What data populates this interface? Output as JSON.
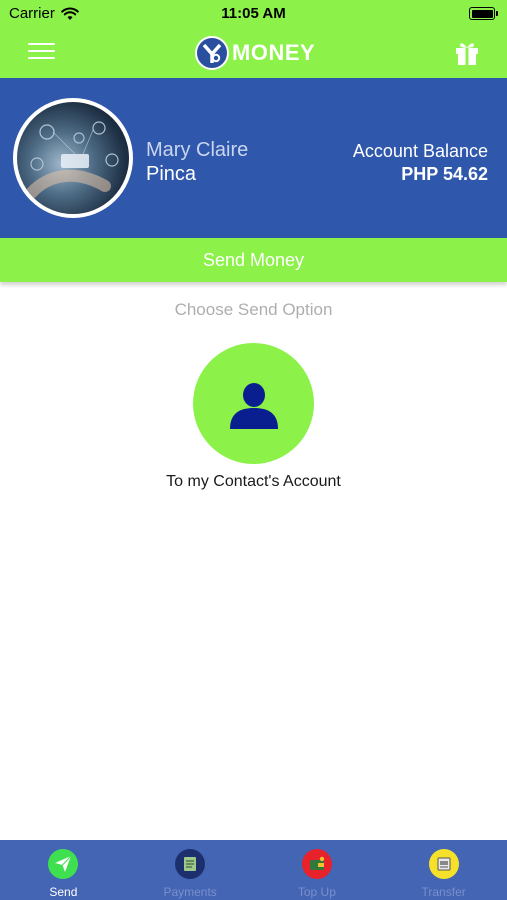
{
  "status": {
    "carrier": "Carrier",
    "time": "11:05 AM"
  },
  "header": {
    "logo_text": "MONEY"
  },
  "profile": {
    "first_name": "Mary Claire",
    "last_name": "Pinca",
    "balance_label": "Account Balance",
    "balance_value": "PHP 54.62"
  },
  "send_bar": {
    "label": "Send Money"
  },
  "main": {
    "choose_text": "Choose Send Option",
    "option_label": "To my Contact's Account"
  },
  "tabs": [
    {
      "label": "Send",
      "icon": "paper-plane-icon",
      "active": true
    },
    {
      "label": "Payments",
      "icon": "bill-icon",
      "active": false
    },
    {
      "label": "Top Up",
      "icon": "wallet-icon",
      "active": false
    },
    {
      "label": "Transfer",
      "icon": "transfer-icon",
      "active": false
    }
  ],
  "colors": {
    "accent_green": "#8cf24a",
    "brand_blue": "#2f57ac",
    "tab_blue": "#4464b4",
    "contact_icon": "#0a1f8f"
  }
}
